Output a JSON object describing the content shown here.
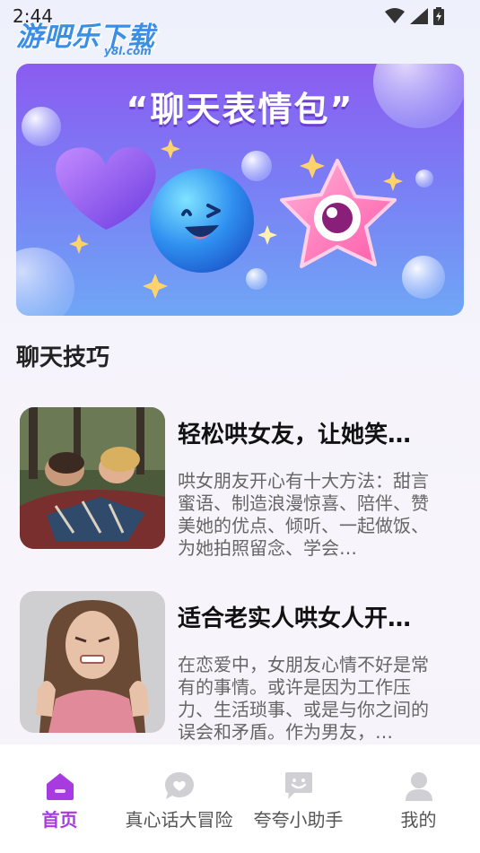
{
  "status_bar": {
    "time": "2:44"
  },
  "watermark": {
    "main": "游吧乐下载",
    "sub": "y8l.com"
  },
  "banner": {
    "title": "“聊天表情包”"
  },
  "section": {
    "title": "聊天技巧"
  },
  "articles": [
    {
      "title": "轻松哄女友，让她笑…",
      "summary": "哄女朋友开心有十大方法：甜言蜜语、制造浪漫惊喜、陪伴、赞美她的优点、倾听、一起做饭、为她拍照留念、学会…"
    },
    {
      "title": "适合老实人哄女人开…",
      "summary": "在恋爱中，女朋友心情不好是常有的事情。或许是因为工作压力、生活琐事、或是与你之间的误会和矛盾。作为男友，…"
    }
  ],
  "tabs": [
    {
      "label": "首页",
      "icon": "home-icon",
      "active": true
    },
    {
      "label": "真心话大冒险",
      "icon": "heart-chat-icon",
      "active": false
    },
    {
      "label": "夸夸小助手",
      "icon": "smile-chat-icon",
      "active": false
    },
    {
      "label": "我的",
      "icon": "profile-icon",
      "active": false
    }
  ],
  "colors": {
    "accent": "#a73be0",
    "inactive_icon": "#cfcfd4"
  }
}
